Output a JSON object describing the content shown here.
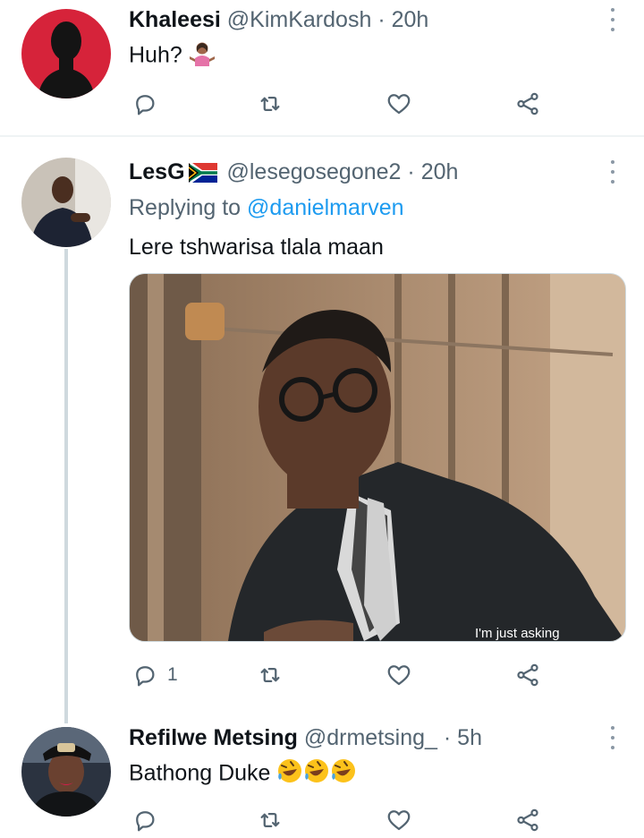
{
  "tweets": [
    {
      "display_name": "Khaleesi",
      "handle": "@KimKardosh",
      "separator": "·",
      "time": "20h",
      "text": "Huh? ",
      "emoji": "woman-shrugging",
      "reply_count": "",
      "avatar_color": "#d6233a"
    },
    {
      "display_name": "LesG",
      "flag": "south-africa-flag",
      "handle": "@lesegosegone2",
      "separator": "·",
      "time": "20h",
      "replying_prefix": "Replying to ",
      "replying_to": "@danielmarven",
      "text": "Lere tshwarisa tlala maan",
      "media_caption": "I'm just asking",
      "reply_count": "1"
    },
    {
      "display_name": "Refilwe Metsing",
      "handle": "@drmetsing_",
      "separator": "·",
      "time": "5h",
      "text": "Bathong Duke ",
      "emoji": "rolling-on-floor-laughing",
      "reply_count": ""
    }
  ],
  "colors": {
    "accent": "#1d9bf0",
    "secondary_text": "#536471",
    "icon": "#536471"
  }
}
